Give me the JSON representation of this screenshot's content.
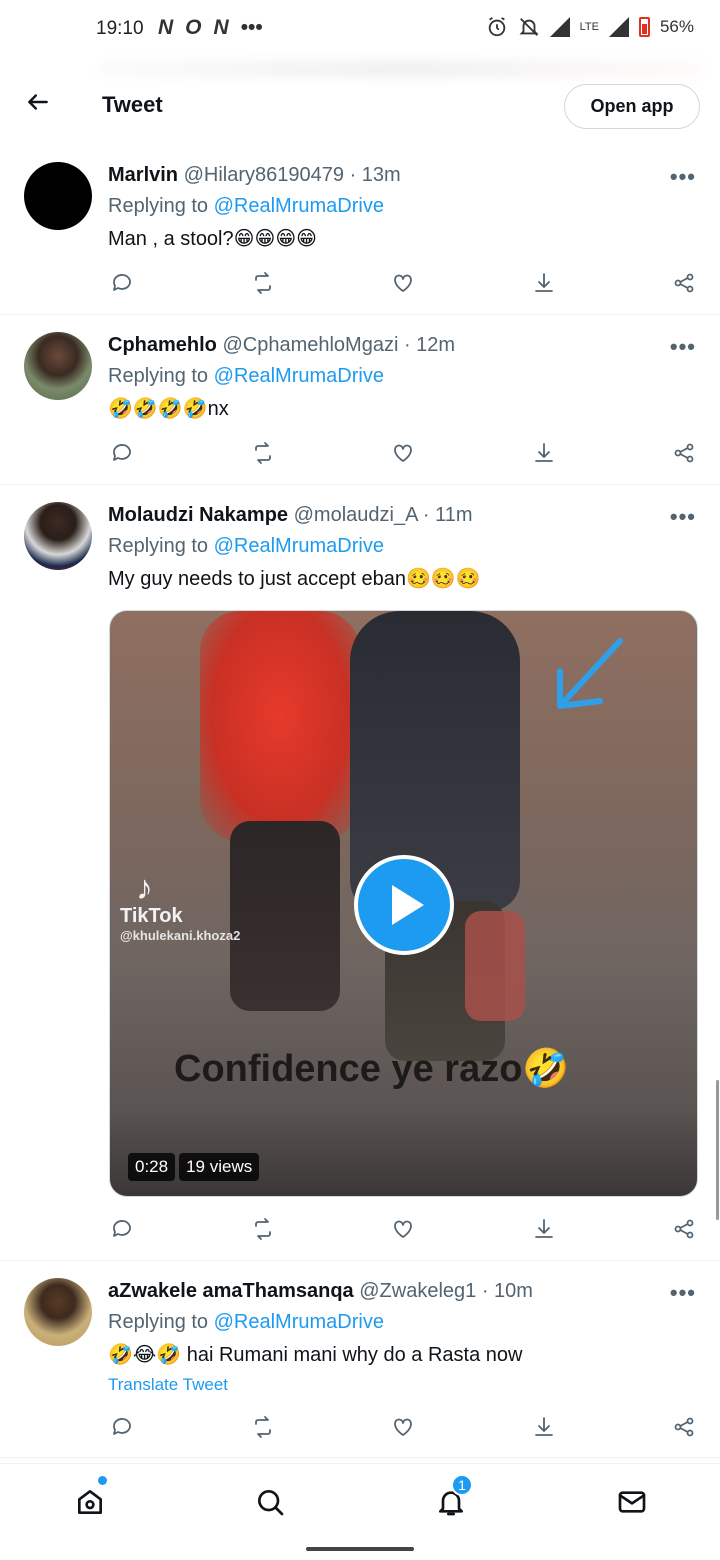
{
  "status_bar": {
    "time": "19:10",
    "left_icons": [
      "N",
      "O",
      "N",
      "•••"
    ],
    "lte": "LTE",
    "battery": "56%"
  },
  "header": {
    "title": "Tweet",
    "open_app": "Open app"
  },
  "tweets": [
    {
      "name": "Marlvin",
      "handle": "@Hilary86190479",
      "time": "· 13m",
      "replying_prefix": "Replying to",
      "replying_to": "@RealMrumaDrive",
      "text": "Man , a stool?😁😁😁😁"
    },
    {
      "name": "Cphamehlo",
      "handle": "@CphamehloMgazi",
      "time": "· 12m",
      "replying_prefix": "Replying to",
      "replying_to": "@RealMrumaDrive",
      "text": "🤣🤣🤣🤣nx"
    },
    {
      "name": "Molaudzi Nakampe",
      "handle": "@molaudzi_A",
      "time": "· 11m",
      "replying_prefix": "Replying to",
      "replying_to": "@RealMrumaDrive",
      "text": "My guy needs to just accept eban🥴🥴🥴",
      "media": {
        "tiktok_name": "TikTok",
        "tiktok_user": "@khulekani.khoza2",
        "caption": "Confidence ye razo🤣",
        "duration": "0:28",
        "views": "19 views"
      }
    },
    {
      "name": "aZwakele amaThamsanqa",
      "handle": "@Zwakeleg1",
      "time": "· 10m",
      "replying_prefix": "Replying to",
      "replying_to": "@RealMrumaDrive",
      "text": "🤣😂🤣 hai Rumani mani why do a Rasta now",
      "translate": "Translate Tweet"
    }
  ],
  "bottom_nav": {
    "notifications_count": "1"
  },
  "colors": {
    "accent": "#1d9bf0",
    "secondary_text": "#536471",
    "primary_text": "#0f1419"
  }
}
